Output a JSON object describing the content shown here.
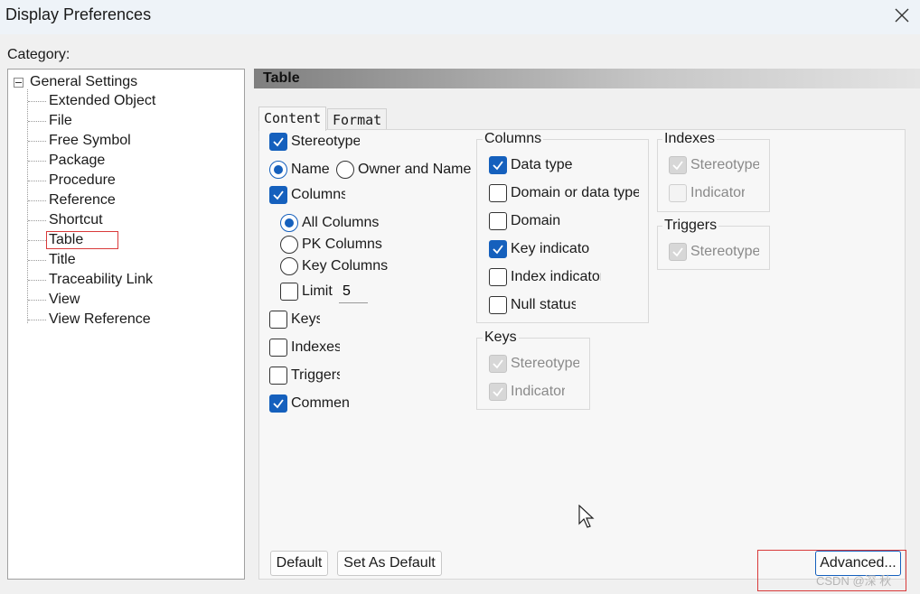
{
  "window": {
    "title": "Display Preferences"
  },
  "category": {
    "label": "Category:",
    "root": "General Settings",
    "items": [
      "Extended Object",
      "File",
      "Free Symbol",
      "Package",
      "Procedure",
      "Reference",
      "Shortcut",
      "Table",
      "Title",
      "Traceability Link",
      "View",
      "View Reference"
    ],
    "selected": "Table"
  },
  "panel": {
    "header": "Table",
    "tabs": [
      "Content",
      "Format"
    ],
    "active_tab": "Content",
    "left": {
      "stereotype": {
        "label": "Stereotype",
        "checked": true
      },
      "name_radio": {
        "label": "Name",
        "selected": true
      },
      "owner_name_radio": {
        "label": "Owner and Name",
        "selected": false
      },
      "columns": {
        "label": "Columns",
        "checked": true
      },
      "all_columns": {
        "label": "All Columns",
        "selected": true
      },
      "pk_columns": {
        "label": "PK Columns",
        "selected": false
      },
      "key_columns": {
        "label": "Key Columns",
        "selected": false
      },
      "limit": {
        "label": "Limit",
        "checked": false,
        "value": "5"
      },
      "keys": {
        "label": "Keys",
        "checked": false
      },
      "indexes": {
        "label": "Indexes",
        "checked": false
      },
      "triggers": {
        "label": "Triggers",
        "checked": false
      },
      "comment": {
        "label": "Comment",
        "checked": true
      }
    },
    "columns_group": {
      "title": "Columns",
      "items": [
        {
          "label": "Data type",
          "checked": true
        },
        {
          "label": "Domain or data type",
          "checked": false
        },
        {
          "label": "Domain",
          "checked": false
        },
        {
          "label": "Key indicator",
          "checked": true
        },
        {
          "label": "Index indicator",
          "checked": false
        },
        {
          "label": "Null status",
          "checked": false
        }
      ]
    },
    "keys_group": {
      "title": "Keys",
      "items": [
        {
          "label": "Stereotype",
          "checked": true
        },
        {
          "label": "Indicator",
          "checked": true
        }
      ]
    },
    "indexes_group": {
      "title": "Indexes",
      "items": [
        {
          "label": "Stereotype",
          "checked": true
        },
        {
          "label": "Indicator",
          "checked": false
        }
      ]
    },
    "triggers_group": {
      "title": "Triggers",
      "items": [
        {
          "label": "Stereotype",
          "checked": true
        }
      ]
    }
  },
  "buttons": {
    "default": "Default",
    "set_as_default": "Set As Default",
    "advanced": "Advanced..."
  },
  "watermark": "CSDN @深   秋",
  "colors": {
    "accent": "#1560bd",
    "highlight": "#d93a3a"
  }
}
